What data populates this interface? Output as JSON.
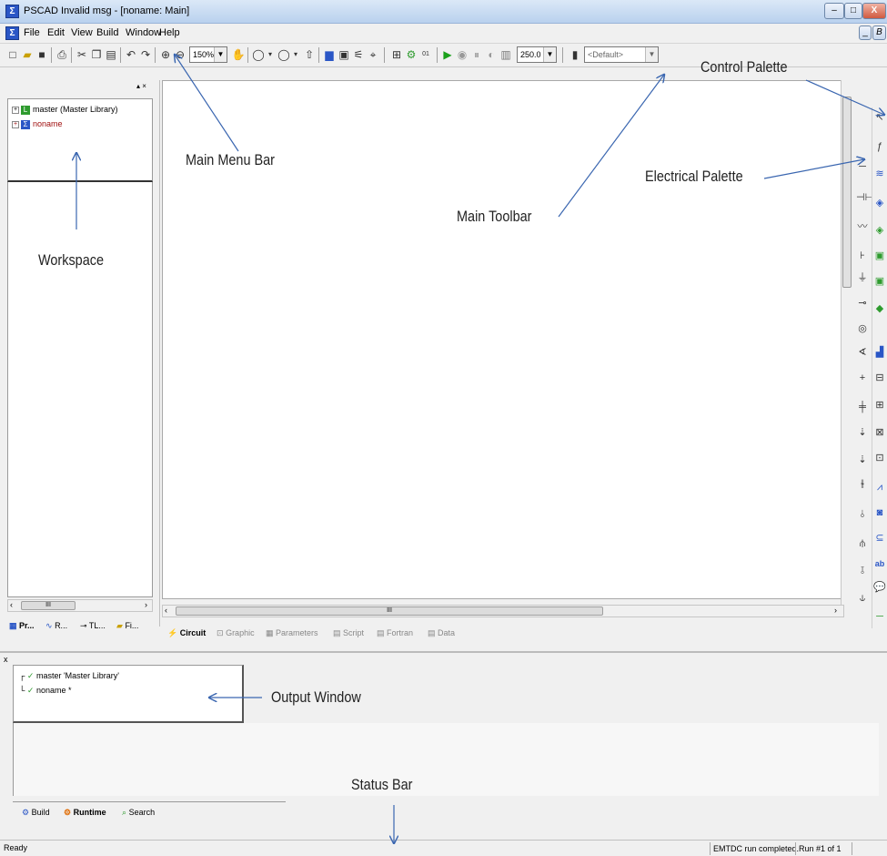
{
  "titlebar": {
    "title": "PSCAD Invalid msg - [noname: Main]",
    "minimize": "–",
    "maximize": "□",
    "close": "X"
  },
  "menubar": {
    "items": [
      "File",
      "Edit",
      "View",
      "Build",
      "Window",
      "Help"
    ],
    "mdi_min": "_",
    "mdi_max": "B"
  },
  "toolbar": {
    "zoom_value": "150%",
    "time_value": "250.0",
    "profile_value": "<Default>"
  },
  "workspace": {
    "tree": [
      {
        "label": "master (Master Library)",
        "icon": "library-icon",
        "color": "#2e9b2e"
      },
      {
        "label": "noname",
        "icon": "project-icon",
        "color": "#2a56c6"
      }
    ],
    "tabs": [
      "Pr...",
      "R...",
      "TL...",
      "Fi..."
    ],
    "scroll_mark": "III"
  },
  "canvas": {
    "tabs": [
      "Circuit",
      "Graphic",
      "Parameters",
      "Script",
      "Fortran",
      "Data"
    ],
    "scroll_mark": "III"
  },
  "output": {
    "tree": [
      "master 'Master Library'",
      "noname *"
    ],
    "tabs": [
      "Build",
      "Runtime",
      "Search"
    ],
    "close": "x"
  },
  "statusbar": {
    "ready": "Ready",
    "message": "EMTDC run completed.",
    "run": "Run #1 of 1"
  },
  "annotations": {
    "control_palette": "Control Palette",
    "main_menu_bar": "Main Menu Bar",
    "electrical_palette": "Electrical Palette",
    "main_toolbar": "Main Toolbar",
    "workspace": "Workspace",
    "output_window": "Output Window",
    "status_bar": "Status Bar"
  },
  "colors": {
    "accent": "#2a56c6",
    "canvas_bg": "#ffffff",
    "chrome": "#f0f0f0"
  }
}
